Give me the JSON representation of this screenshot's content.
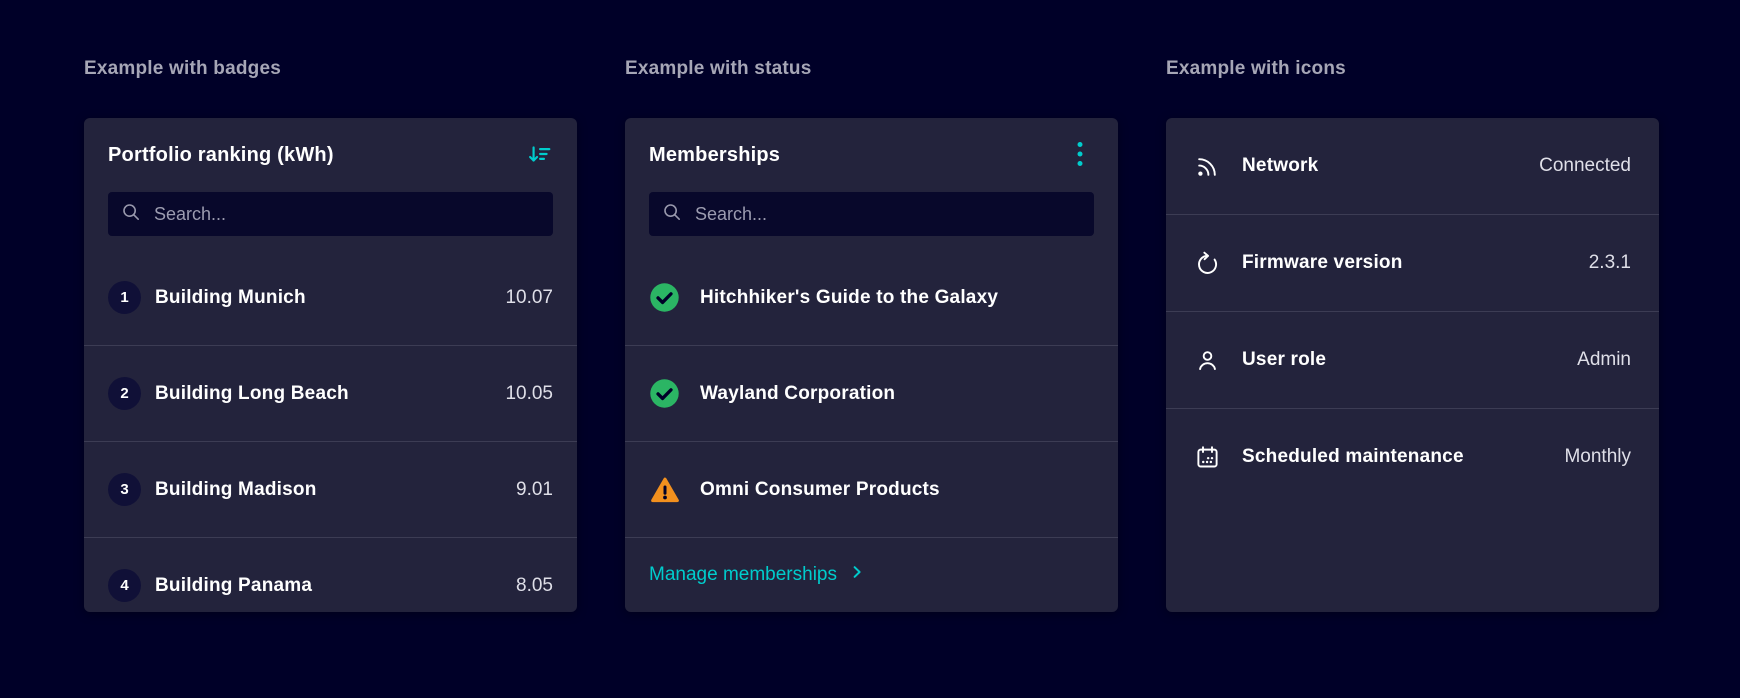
{
  "colors": {
    "background": "#000028",
    "card": "#23233C",
    "accent": "#00CCCC",
    "success": "#2BB564",
    "warning": "#F2901E",
    "divider": "#3C3C54"
  },
  "sections": [
    {
      "title": "Example with badges",
      "card": {
        "header": {
          "title": "Portfolio ranking (kWh)",
          "action_icon": "sort-descending-icon"
        },
        "search": {
          "placeholder": "Search...",
          "value": "",
          "icon": "search-icon"
        },
        "rows": [
          {
            "badge": "1",
            "label": "Building Munich",
            "value": "10.07"
          },
          {
            "badge": "2",
            "label": "Building Long Beach",
            "value": "10.05"
          },
          {
            "badge": "3",
            "label": "Building Madison",
            "value": "9.01"
          },
          {
            "badge": "4",
            "label": "Building Panama",
            "value": "8.05"
          }
        ]
      }
    },
    {
      "title": "Example with status",
      "card": {
        "header": {
          "title": "Memberships",
          "action_icon": "kebab-menu-icon"
        },
        "search": {
          "placeholder": "Search...",
          "value": "",
          "icon": "search-icon"
        },
        "rows": [
          {
            "status_icon": "success-check-icon",
            "label": "Hitchhiker's Guide to the Galaxy"
          },
          {
            "status_icon": "success-check-icon",
            "label": "Wayland Corporation"
          },
          {
            "status_icon": "warning-triangle-icon",
            "label": "Omni Consumer Products"
          }
        ],
        "footer_link": {
          "label": "Manage memberships",
          "icon": "chevron-right-icon"
        }
      }
    },
    {
      "title": "Example with icons",
      "card": {
        "rows": [
          {
            "icon": "network-icon",
            "label": "Network",
            "value": "Connected"
          },
          {
            "icon": "refresh-icon",
            "label": "Firmware version",
            "value": "2.3.1"
          },
          {
            "icon": "user-icon",
            "label": "User role",
            "value": "Admin"
          },
          {
            "icon": "calendar-icon",
            "label": "Scheduled maintenance",
            "value": "Monthly"
          }
        ]
      }
    }
  ]
}
